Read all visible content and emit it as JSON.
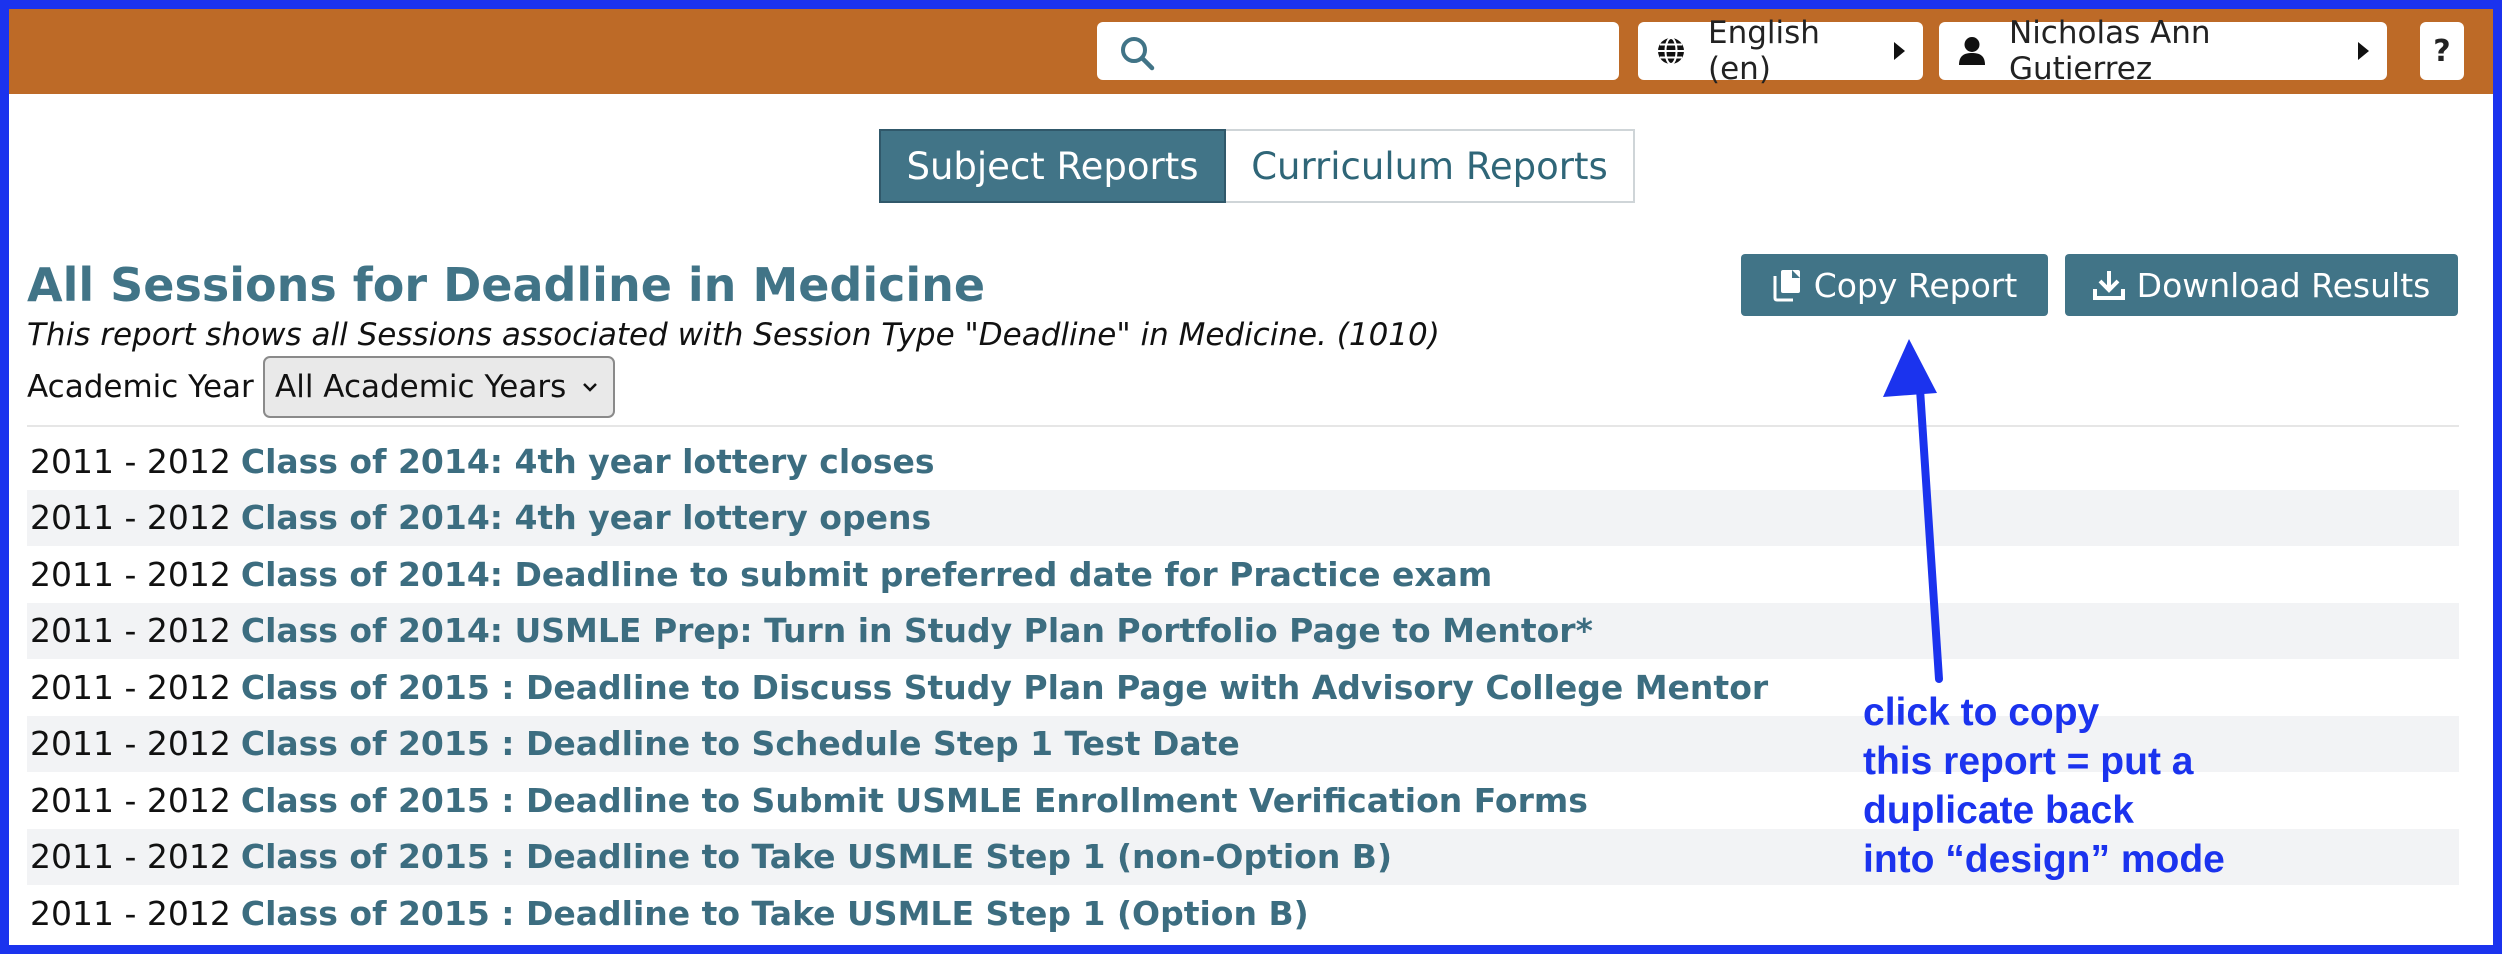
{
  "topbar": {
    "search": {
      "placeholder": "",
      "value": ""
    },
    "language_label": "English (en)",
    "user_name": "Nicholas Ann Gutierrez",
    "help_label": "?"
  },
  "tabs": [
    {
      "label": "Subject Reports",
      "active": true
    },
    {
      "label": "Curriculum Reports",
      "active": false
    }
  ],
  "report": {
    "title": "All Sessions for Deadline in Medicine",
    "description": "This report shows all Sessions associated with Session Type \"Deadline\" in Medicine. (1010)",
    "academic_year_label": "Academic Year",
    "academic_year_selected": "All Academic Years"
  },
  "actions": {
    "copy_label": "Copy Report",
    "download_label": "Download Results"
  },
  "sessions": [
    {
      "year": "2011 - 2012",
      "title": "Class of 2014: 4th year lottery closes"
    },
    {
      "year": "2011 - 2012",
      "title": "Class of 2014: 4th year lottery opens"
    },
    {
      "year": "2011 - 2012",
      "title": "Class of 2014: Deadline to submit preferred date for Practice exam"
    },
    {
      "year": "2011 - 2012",
      "title": "Class of 2014: USMLE Prep: Turn in Study Plan Portfolio Page to Mentor*"
    },
    {
      "year": "2011 - 2012",
      "title": "Class of 2015 : Deadline to Discuss Study Plan Page with Advisory College Mentor"
    },
    {
      "year": "2011 - 2012",
      "title": "Class of 2015 : Deadline to Schedule Step 1 Test Date"
    },
    {
      "year": "2011 - 2012",
      "title": "Class of 2015 : Deadline to Submit USMLE Enrollment Verification Forms"
    },
    {
      "year": "2011 - 2012",
      "title": "Class of 2015 : Deadline to Take USMLE Step 1 (non-Option B)"
    },
    {
      "year": "2011 - 2012",
      "title": "Class of 2015 : Deadline to Take USMLE Step 1 (Option B)"
    }
  ],
  "annotation": {
    "lines": [
      "click to copy",
      "this report = put a",
      "duplicate back",
      "into “design” mode"
    ],
    "color": "#1b33ee"
  },
  "colors": {
    "topbar": "#bd6a27",
    "accent": "#417487",
    "link": "#3c6d80",
    "frame": "#1b33ee"
  },
  "icons": [
    "search-icon",
    "globe-icon",
    "user-icon",
    "caret-right-icon",
    "copy-icon",
    "download-icon",
    "chevron-down-icon",
    "arrow-icon"
  ]
}
